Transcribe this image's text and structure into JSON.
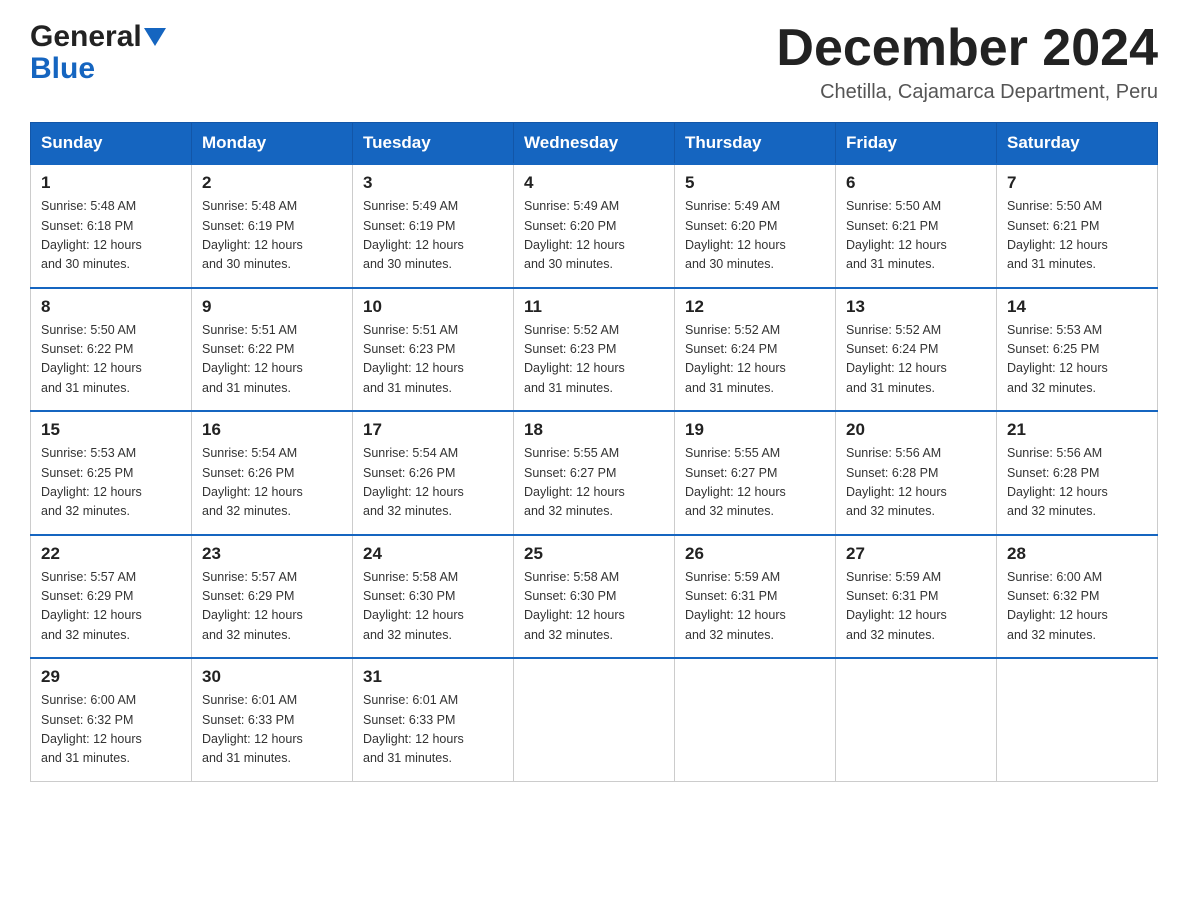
{
  "header": {
    "logo_general": "General",
    "logo_blue": "Blue",
    "main_title": "December 2024",
    "subtitle": "Chetilla, Cajamarca Department, Peru"
  },
  "calendar": {
    "days_of_week": [
      "Sunday",
      "Monday",
      "Tuesday",
      "Wednesday",
      "Thursday",
      "Friday",
      "Saturday"
    ],
    "weeks": [
      [
        {
          "num": "1",
          "sunrise": "5:48 AM",
          "sunset": "6:18 PM",
          "daylight": "12 hours and 30 minutes."
        },
        {
          "num": "2",
          "sunrise": "5:48 AM",
          "sunset": "6:19 PM",
          "daylight": "12 hours and 30 minutes."
        },
        {
          "num": "3",
          "sunrise": "5:49 AM",
          "sunset": "6:19 PM",
          "daylight": "12 hours and 30 minutes."
        },
        {
          "num": "4",
          "sunrise": "5:49 AM",
          "sunset": "6:20 PM",
          "daylight": "12 hours and 30 minutes."
        },
        {
          "num": "5",
          "sunrise": "5:49 AM",
          "sunset": "6:20 PM",
          "daylight": "12 hours and 30 minutes."
        },
        {
          "num": "6",
          "sunrise": "5:50 AM",
          "sunset": "6:21 PM",
          "daylight": "12 hours and 31 minutes."
        },
        {
          "num": "7",
          "sunrise": "5:50 AM",
          "sunset": "6:21 PM",
          "daylight": "12 hours and 31 minutes."
        }
      ],
      [
        {
          "num": "8",
          "sunrise": "5:50 AM",
          "sunset": "6:22 PM",
          "daylight": "12 hours and 31 minutes."
        },
        {
          "num": "9",
          "sunrise": "5:51 AM",
          "sunset": "6:22 PM",
          "daylight": "12 hours and 31 minutes."
        },
        {
          "num": "10",
          "sunrise": "5:51 AM",
          "sunset": "6:23 PM",
          "daylight": "12 hours and 31 minutes."
        },
        {
          "num": "11",
          "sunrise": "5:52 AM",
          "sunset": "6:23 PM",
          "daylight": "12 hours and 31 minutes."
        },
        {
          "num": "12",
          "sunrise": "5:52 AM",
          "sunset": "6:24 PM",
          "daylight": "12 hours and 31 minutes."
        },
        {
          "num": "13",
          "sunrise": "5:52 AM",
          "sunset": "6:24 PM",
          "daylight": "12 hours and 31 minutes."
        },
        {
          "num": "14",
          "sunrise": "5:53 AM",
          "sunset": "6:25 PM",
          "daylight": "12 hours and 32 minutes."
        }
      ],
      [
        {
          "num": "15",
          "sunrise": "5:53 AM",
          "sunset": "6:25 PM",
          "daylight": "12 hours and 32 minutes."
        },
        {
          "num": "16",
          "sunrise": "5:54 AM",
          "sunset": "6:26 PM",
          "daylight": "12 hours and 32 minutes."
        },
        {
          "num": "17",
          "sunrise": "5:54 AM",
          "sunset": "6:26 PM",
          "daylight": "12 hours and 32 minutes."
        },
        {
          "num": "18",
          "sunrise": "5:55 AM",
          "sunset": "6:27 PM",
          "daylight": "12 hours and 32 minutes."
        },
        {
          "num": "19",
          "sunrise": "5:55 AM",
          "sunset": "6:27 PM",
          "daylight": "12 hours and 32 minutes."
        },
        {
          "num": "20",
          "sunrise": "5:56 AM",
          "sunset": "6:28 PM",
          "daylight": "12 hours and 32 minutes."
        },
        {
          "num": "21",
          "sunrise": "5:56 AM",
          "sunset": "6:28 PM",
          "daylight": "12 hours and 32 minutes."
        }
      ],
      [
        {
          "num": "22",
          "sunrise": "5:57 AM",
          "sunset": "6:29 PM",
          "daylight": "12 hours and 32 minutes."
        },
        {
          "num": "23",
          "sunrise": "5:57 AM",
          "sunset": "6:29 PM",
          "daylight": "12 hours and 32 minutes."
        },
        {
          "num": "24",
          "sunrise": "5:58 AM",
          "sunset": "6:30 PM",
          "daylight": "12 hours and 32 minutes."
        },
        {
          "num": "25",
          "sunrise": "5:58 AM",
          "sunset": "6:30 PM",
          "daylight": "12 hours and 32 minutes."
        },
        {
          "num": "26",
          "sunrise": "5:59 AM",
          "sunset": "6:31 PM",
          "daylight": "12 hours and 32 minutes."
        },
        {
          "num": "27",
          "sunrise": "5:59 AM",
          "sunset": "6:31 PM",
          "daylight": "12 hours and 32 minutes."
        },
        {
          "num": "28",
          "sunrise": "6:00 AM",
          "sunset": "6:32 PM",
          "daylight": "12 hours and 32 minutes."
        }
      ],
      [
        {
          "num": "29",
          "sunrise": "6:00 AM",
          "sunset": "6:32 PM",
          "daylight": "12 hours and 31 minutes."
        },
        {
          "num": "30",
          "sunrise": "6:01 AM",
          "sunset": "6:33 PM",
          "daylight": "12 hours and 31 minutes."
        },
        {
          "num": "31",
          "sunrise": "6:01 AM",
          "sunset": "6:33 PM",
          "daylight": "12 hours and 31 minutes."
        },
        null,
        null,
        null,
        null
      ]
    ],
    "labels": {
      "sunrise": "Sunrise: ",
      "sunset": "Sunset: ",
      "daylight": "Daylight: "
    }
  }
}
